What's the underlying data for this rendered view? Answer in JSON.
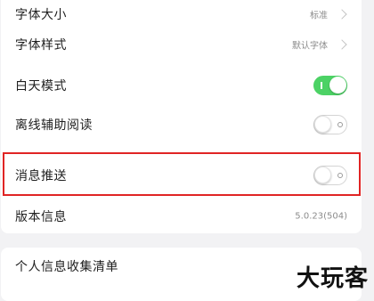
{
  "settings": {
    "font_size": {
      "label": "字体大小",
      "value": "标准"
    },
    "font_style": {
      "label": "字体样式",
      "value": "默认字体"
    },
    "day_mode": {
      "label": "白天模式",
      "enabled": true
    },
    "offline_reading": {
      "label": "离线辅助阅读",
      "enabled": false
    },
    "push_notifications": {
      "label": "消息推送",
      "enabled": false
    },
    "version": {
      "label": "版本信息",
      "value": "5.0.23(504)"
    }
  },
  "privacy": {
    "personal_info_label": "个人信息收集清单"
  },
  "colors": {
    "toggle_on": "#4cd265",
    "highlight_box": "#e02424"
  },
  "watermark": "大玩客"
}
